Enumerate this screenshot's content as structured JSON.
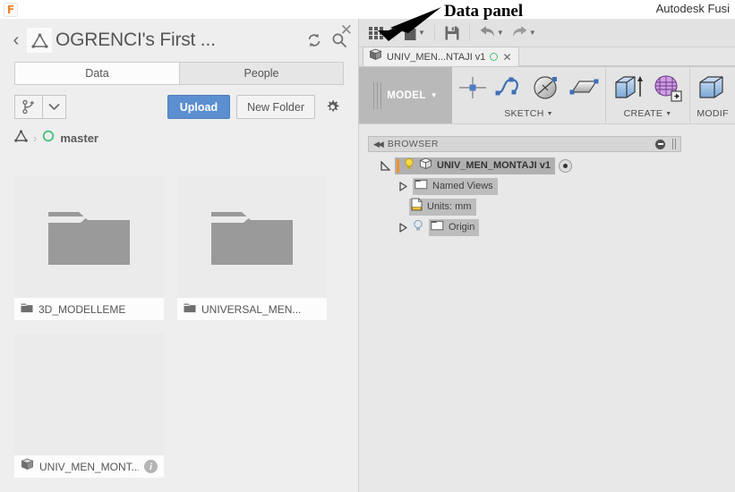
{
  "window": {
    "app_icon": "fusion-f-icon",
    "title": "Autodesk Fusi"
  },
  "annotation": {
    "label": "Data panel",
    "arrow": "arrow-pointing-to-data-panel-button"
  },
  "data_panel": {
    "back_icon": "chevron-left-icon",
    "project_icon": "fusion-project-triangle-icon",
    "title": "OGRENCI's First ...",
    "refresh_icon": "refresh-icon",
    "search_icon": "search-icon",
    "close_icon": "close-icon",
    "tabs": [
      {
        "label": "Data",
        "active": true
      },
      {
        "label": "People",
        "active": false
      }
    ],
    "actions": {
      "branch_icon": "new-branch-icon",
      "branch_caret_icon": "chevron-down-icon",
      "upload_label": "Upload",
      "new_folder_label": "New Folder",
      "settings_icon": "gear-icon",
      "upload_color": "#5b8fd0"
    },
    "breadcrumb": {
      "root_icon": "fusion-project-triangle-icon",
      "separator": "›",
      "branch_icon": "branch-circle-icon",
      "branch_color": "#49c17a",
      "current": "master"
    },
    "cards": [
      {
        "name": "3D_MODELLEME",
        "type": "folder",
        "icon": "folder-icon",
        "has_info": false
      },
      {
        "name": "UNIVERSAL_MEN...",
        "type": "folder",
        "icon": "folder-icon",
        "has_info": false
      },
      {
        "name": "UNIV_MEN_MONT...",
        "type": "design",
        "icon": "cube-icon",
        "has_info": true,
        "info_icon": "info-icon"
      }
    ]
  },
  "fusion": {
    "toolbar": [
      {
        "name": "show-data-panel-button",
        "icon": "grid-icon",
        "caret": false
      },
      {
        "name": "file-menu-button",
        "icon": "file-icon",
        "caret": true
      },
      {
        "name": "save-button",
        "icon": "save-floppy-icon",
        "caret": false
      },
      {
        "name": "undo-button",
        "icon": "undo-arrow-icon",
        "caret": true
      },
      {
        "name": "redo-button",
        "icon": "redo-arrow-icon",
        "caret": true
      }
    ],
    "document_tab": {
      "icon": "cube-icon",
      "label": "UNIV_MEN...NTAJI v1",
      "status_icon": "green-circle-icon",
      "close_icon": "close-icon"
    },
    "workspace": {
      "label": "MODEL",
      "caret_icon": "chevron-down-icon"
    },
    "ribbon_panels": [
      {
        "title": "SKETCH",
        "caret_icon": "chevron-down-icon",
        "tools": [
          {
            "name": "sketch-point-tool",
            "icon": "crosshair-point-icon"
          },
          {
            "name": "sketch-spline-tool",
            "icon": "spline-curve-icon"
          },
          {
            "name": "sketch-circle-tool",
            "icon": "circle-diameter-icon"
          },
          {
            "name": "sketch-rectangle-tool",
            "icon": "rectangle-icon"
          }
        ]
      },
      {
        "title": "CREATE",
        "caret_icon": "chevron-down-icon",
        "tools": [
          {
            "name": "extrude-tool",
            "icon": "extrude-box-arrow-icon"
          },
          {
            "name": "create-form-tool",
            "icon": "tspline-form-icon"
          }
        ]
      },
      {
        "title": "MODIF",
        "caret_icon": "",
        "tools": [
          {
            "name": "press-pull-tool",
            "icon": "press-pull-box-icon"
          }
        ]
      }
    ],
    "browser": {
      "collapse_icon": "collapse-left-icon",
      "title": "BROWSER",
      "minimize_icon": "minus-circle-icon",
      "grip_icon": "drag-grip-icon",
      "tree": [
        {
          "label": "UNIV_MEN_MONTAJI v1",
          "icon": "cube-icon",
          "bulb_icon": "lightbulb-on-icon",
          "expander": "triangle-expanded-icon",
          "root": true,
          "trailing_icon": "target-dot-icon",
          "accent": "#f0922b"
        },
        {
          "label": "Named Views",
          "icon": "folder-icon",
          "expander": "triangle-collapsed-icon",
          "root": false
        },
        {
          "label": "Units: mm",
          "icon": "document-ruler-icon",
          "expander": "",
          "root": false
        },
        {
          "label": "Origin",
          "icon": "folder-icon",
          "bulb_icon": "lightbulb-off-icon",
          "expander": "triangle-collapsed-icon",
          "root": false
        }
      ]
    }
  }
}
